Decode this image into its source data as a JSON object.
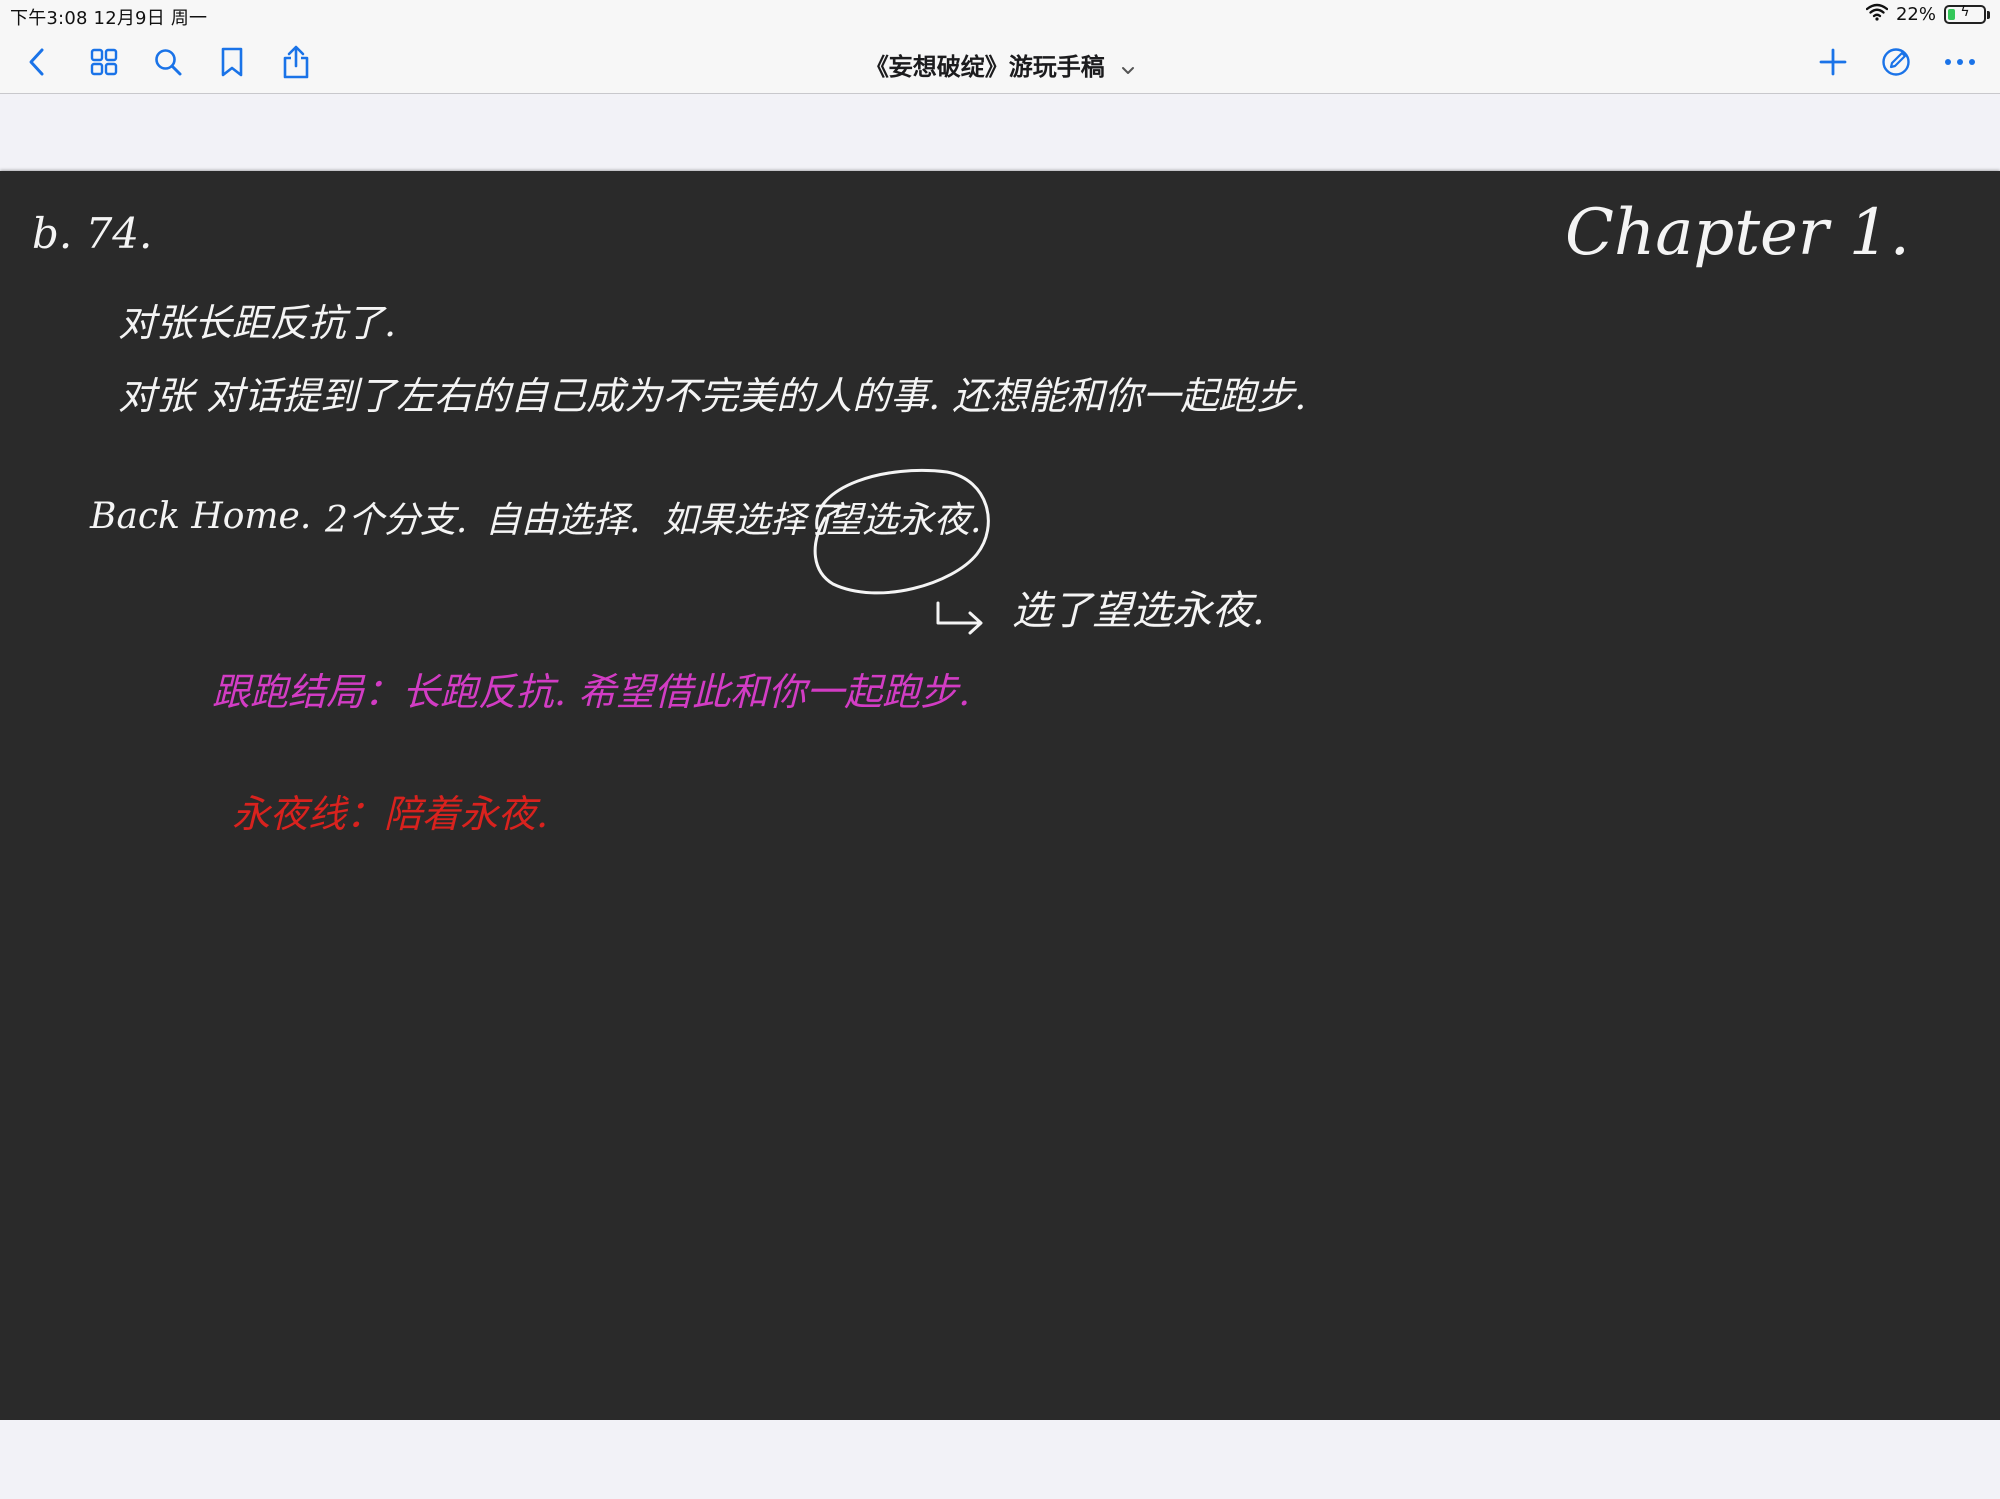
{
  "status_bar": {
    "time": "下午3:08   12月9日 周一",
    "battery_percent": "22%",
    "battery_level": 0.22,
    "icons": [
      "wifi-icon",
      "battery-icon",
      "charging-bolt-icon"
    ]
  },
  "toolbar": {
    "title": "《妄想破绽》游玩手稿",
    "left_icons": [
      "back-chevron-icon",
      "grid-icon",
      "search-icon",
      "bookmark-icon",
      "share-icon"
    ],
    "right_icons": [
      "plus-icon",
      "pencil-circle-icon",
      "more-icon"
    ],
    "accent_color": "#1a73e8"
  },
  "note": {
    "background": "#2a2a2a",
    "header_left": "b. 74.",
    "header_right": "Chapter 1.",
    "line1": "对张长距反抗了.",
    "line2": "对张 对话提到了左右的自己成为不完美的人的事. 还想能和你一起跑步.",
    "line3_prefix": "Back Home.",
    "line3_part2": "2个分支.",
    "line3_part3": "自由选择.",
    "line3_part4": "如果选择了",
    "line3_circled": "望选永夜.",
    "arrow_line": "选了望选永夜.",
    "magenta_line": "跟跑结局：长跑反抗. 希望借此和你一起跑步.",
    "red_line": "永夜线：陪着永夜.",
    "colors": {
      "white": "#f4f4f4",
      "magenta": "#d23cc4",
      "red": "#d9221e"
    }
  }
}
